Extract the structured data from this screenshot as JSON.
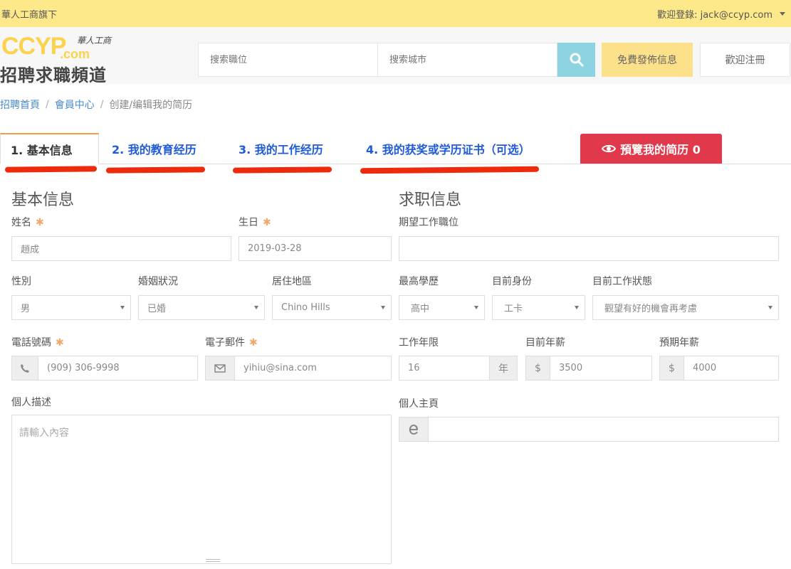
{
  "topbar": {
    "left_text": "華人工商旗下",
    "welcome": "歡迎登錄: jack@ccyp.com"
  },
  "logo": {
    "brand": "CCYP",
    "domain": ".com",
    "tagline": "華人工商",
    "channel": "招聘求職頻道"
  },
  "search": {
    "job_placeholder": "搜索職位",
    "city_placeholder": "搜索城市"
  },
  "header": {
    "post_label": "免費發佈信息",
    "register_label": "歡迎注冊"
  },
  "breadcrumb": {
    "home": "招聘首頁",
    "member": "會員中心",
    "current": "创建/编辑我的简历",
    "sep": "/"
  },
  "tabs": [
    {
      "label": "1. 基本信息"
    },
    {
      "label": "2. 我的教育经历"
    },
    {
      "label": "3. 我的工作经历"
    },
    {
      "label": "4. 我的获奖或学历证书（可选）"
    }
  ],
  "preview": {
    "label": "預覽我的简历 0"
  },
  "basic": {
    "title": "基本信息",
    "name_label": "姓名",
    "name_value": "趙成",
    "birth_label": "生日",
    "birth_value": "2019-03-28",
    "gender_label": "性別",
    "gender_value": "男",
    "marital_label": "婚姻狀況",
    "marital_value": "已婚",
    "region_label": "居住地區",
    "region_value": "Chino Hills",
    "phone_label": "電話號碼",
    "phone_value": "(909) 306-9998",
    "email_label": "電子郵件",
    "email_value": "yihiu@sina.com",
    "desc_label": "個人描述",
    "desc_placeholder": "請輸入內容"
  },
  "job": {
    "title": "求职信息",
    "position_label": "期望工作職位",
    "position_value": "",
    "edu_label": "最高學歷",
    "edu_value": "高中",
    "status_label": "目前身份",
    "status_value": "工卡",
    "work_state_label": "目前工作狀態",
    "work_state_value": "觀望有好的機會再考慮",
    "years_label": "工作年限",
    "years_value": "16",
    "years_unit": "年",
    "cur_salary_label": "目前年薪",
    "cur_salary_value": "3500",
    "exp_salary_label": "預期年薪",
    "exp_salary_value": "4000",
    "currency": "$",
    "homepage_label": "個人主頁",
    "homepage_value": ""
  },
  "colors": {
    "topbar": "#fde88a",
    "accent_blue": "#1f5bd9",
    "preview_red": "#e0394b",
    "search_btn": "#8ed3e1",
    "required": "#f3a86a",
    "annotation_red": "#ee2a0d"
  }
}
